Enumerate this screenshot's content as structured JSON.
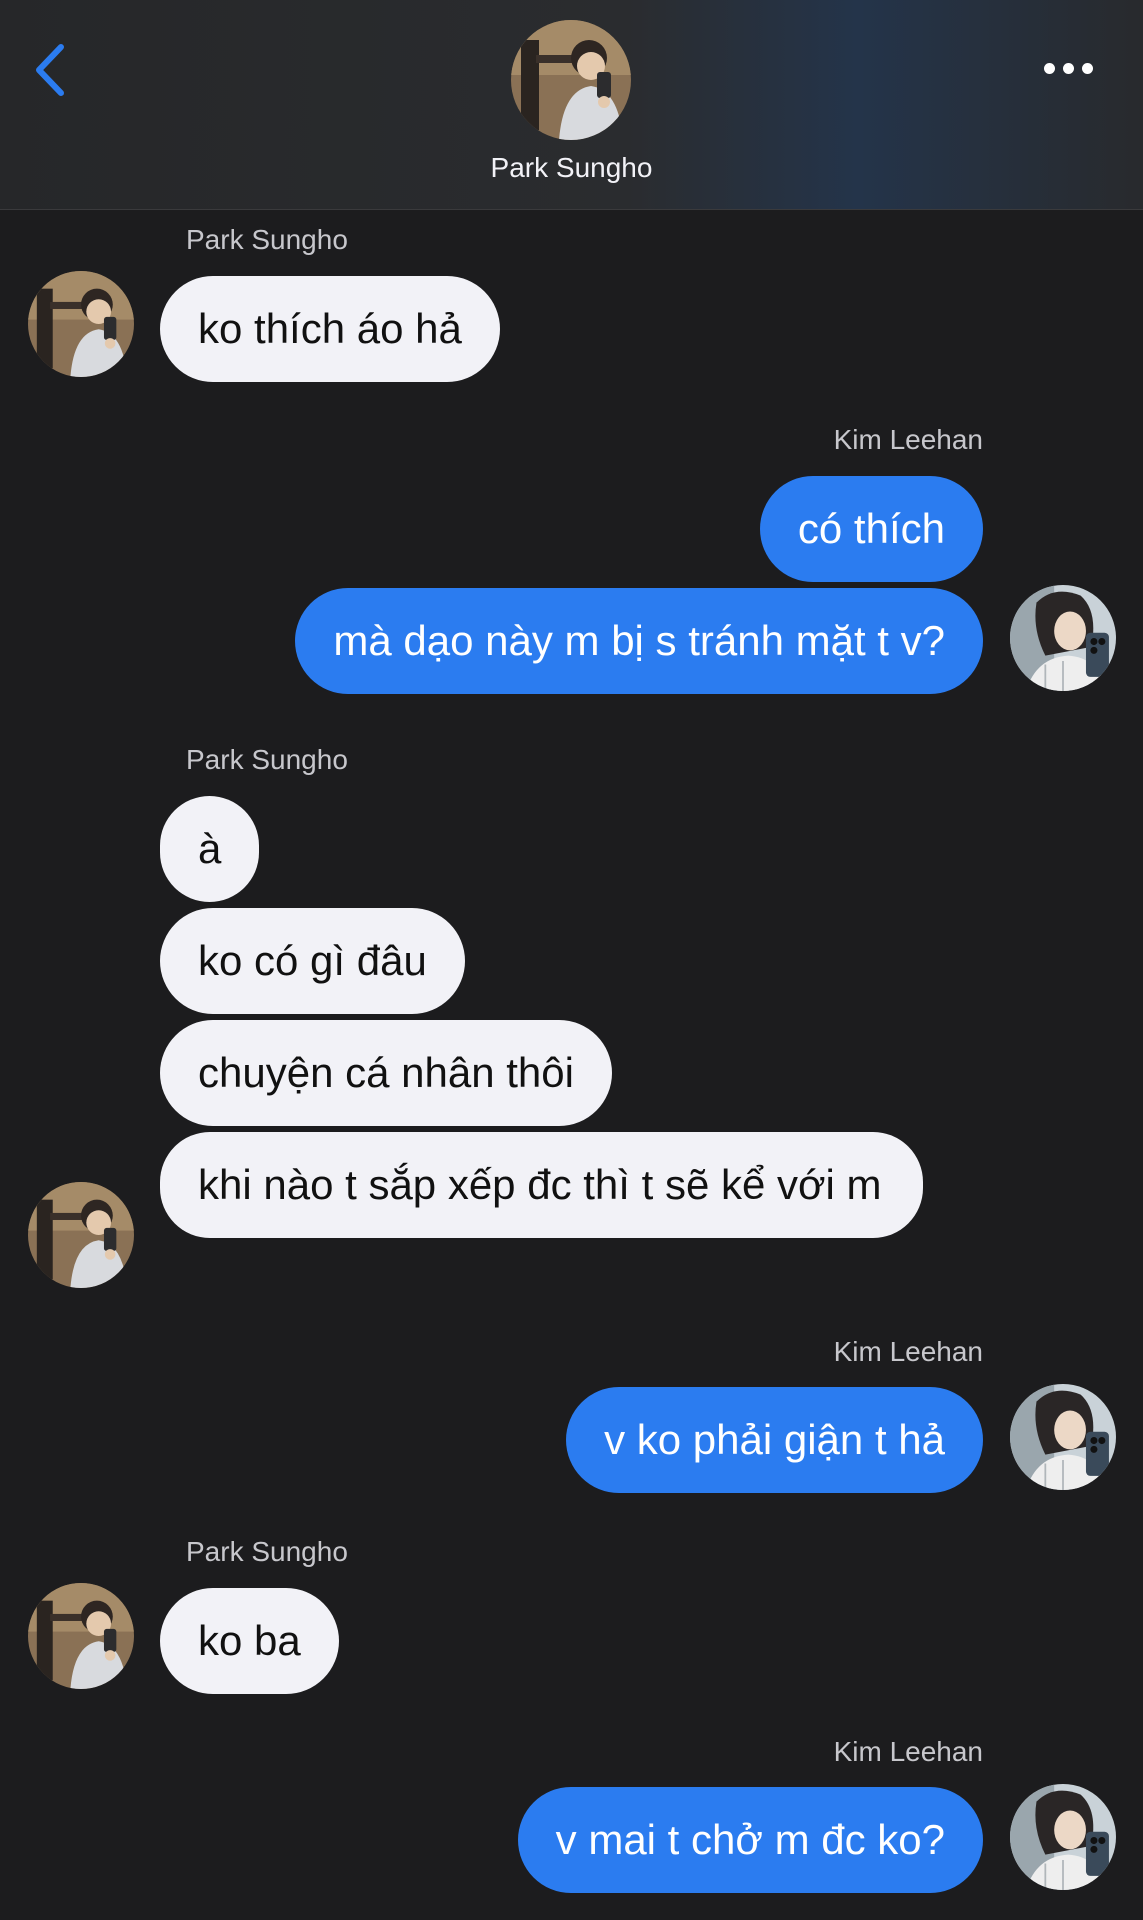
{
  "header": {
    "title": "Park Sungho",
    "back_icon": "chevron-left-icon",
    "more_icon": "more-horizontal-icon",
    "accent_color": "#2b7cf0"
  },
  "conversation": {
    "contact_name": "Park Sungho",
    "self_name": "Kim Leehan",
    "groups": [
      {
        "sender": "Park Sungho",
        "messages": [
          "ko thích áo hả"
        ]
      },
      {
        "sender": "Kim Leehan",
        "messages": [
          "có thích",
          "mà dạo này m bị s tránh mặt t v?"
        ]
      },
      {
        "sender": "Park Sungho",
        "messages": [
          "à",
          "ko có gì đâu",
          "chuyện cá nhân thôi",
          "khi nào t sắp xếp đc thì t sẽ kể với m"
        ]
      },
      {
        "sender": "Kim Leehan",
        "messages": [
          "v ko phải giận t hả"
        ]
      },
      {
        "sender": "Park Sungho",
        "messages": [
          "ko ba"
        ]
      },
      {
        "sender": "Kim Leehan",
        "messages": [
          "v mai t chở m đc ko?"
        ]
      }
    ]
  }
}
